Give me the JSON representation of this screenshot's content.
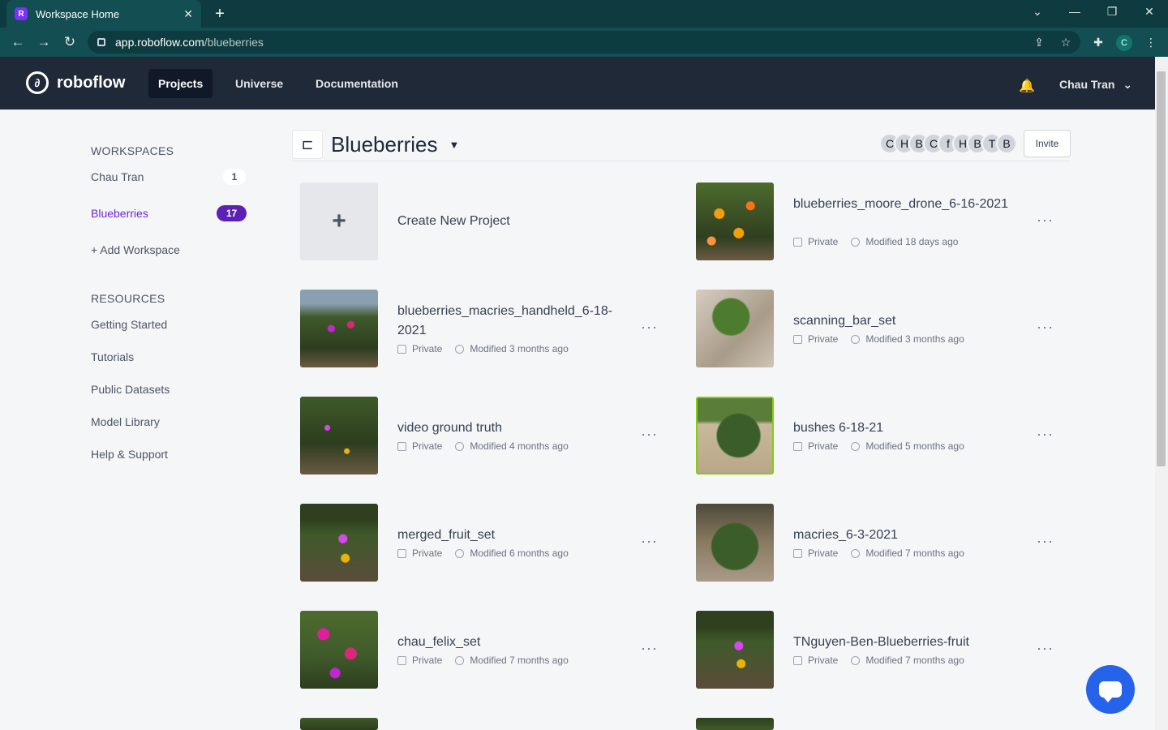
{
  "browser": {
    "tab_title": "Workspace Home",
    "url_host": "app.roboflow.com",
    "url_path": "/blueberries",
    "profile_initial": "C"
  },
  "header": {
    "brand": "roboflow",
    "nav": [
      {
        "label": "Projects",
        "active": true
      },
      {
        "label": "Universe",
        "active": false
      },
      {
        "label": "Documentation",
        "active": false
      }
    ],
    "user_name": "Chau Tran"
  },
  "sidebar": {
    "workspaces_heading": "WORKSPACES",
    "workspaces": [
      {
        "label": "Chau Tran",
        "count": "1",
        "active": false
      },
      {
        "label": "Blueberries",
        "count": "17",
        "active": true
      }
    ],
    "add_workspace": "+ Add Workspace",
    "resources_heading": "RESOURCES",
    "resources": [
      "Getting Started",
      "Tutorials",
      "Public Datasets",
      "Model Library",
      "Help & Support"
    ]
  },
  "workspace": {
    "name": "Blueberries",
    "member_initials": [
      "C",
      "H",
      "B",
      "C",
      "f",
      "H",
      "B",
      "T",
      "B"
    ],
    "invite_label": "Invite"
  },
  "create_project_label": "Create New Project",
  "projects": [
    {
      "name": "blueberries_moore_drone_6-16-2021",
      "visibility": "Private",
      "modified": "Modified 18 days ago"
    },
    {
      "name": "blueberries_macries_handheld_6-18-2021",
      "visibility": "Private",
      "modified": "Modified 3 months ago"
    },
    {
      "name": "scanning_bar_set",
      "visibility": "Private",
      "modified": "Modified 3 months ago"
    },
    {
      "name": "video ground truth",
      "visibility": "Private",
      "modified": "Modified 4 months ago"
    },
    {
      "name": "bushes 6-18-21",
      "visibility": "Private",
      "modified": "Modified 5 months ago"
    },
    {
      "name": "merged_fruit_set",
      "visibility": "Private",
      "modified": "Modified 6 months ago"
    },
    {
      "name": "macries_6-3-2021",
      "visibility": "Private",
      "modified": "Modified 7 months ago"
    },
    {
      "name": "chau_felix_set",
      "visibility": "Private",
      "modified": "Modified 7 months ago"
    },
    {
      "name": "TNguyen-Ben-Blueberries-fruit",
      "visibility": "Private",
      "modified": "Modified 7 months ago"
    }
  ],
  "more_label": "···",
  "colors": {
    "accent_purple": "#5b21b6",
    "header_bg": "#1f2937",
    "browser_bg": "#124e52",
    "chat_blue": "#2563eb"
  }
}
